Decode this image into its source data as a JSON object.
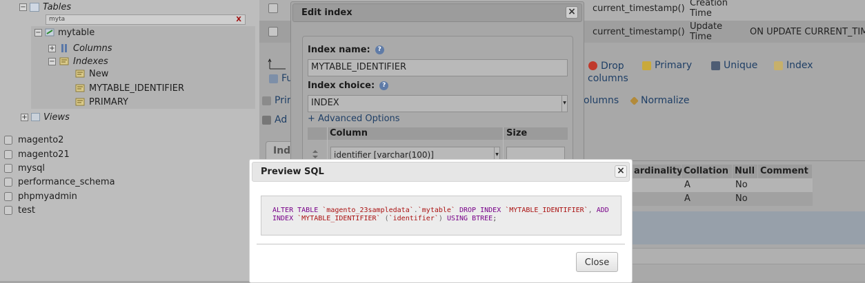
{
  "sidebar": {
    "tables_label": "Tables",
    "filter_value": "myta",
    "filter_clear": "X",
    "table_name": "mytable",
    "columns_label": "Columns",
    "indexes_label": "Indexes",
    "indexes_items": [
      "New",
      "MYTABLE_IDENTIFIER",
      "PRIMARY"
    ],
    "views_label": "Views",
    "databases": [
      "magento2",
      "magento21",
      "mysql",
      "performance_schema",
      "phpmyadmin",
      "test"
    ]
  },
  "main": {
    "rows": [
      {
        "default": "current_timestamp()",
        "comment_line1": "Creation",
        "comment_line2": "Time",
        "extra": ""
      },
      {
        "default": "current_timestamp()",
        "comment_line1": "Update",
        "comment_line2": "Time",
        "extra": "ON UPDATE CURRENT_TIM"
      }
    ],
    "actions": {
      "drop_line1": "Drop",
      "drop_line2": "columns",
      "primary": "Primary",
      "unique": "Unique",
      "index": "Index",
      "print_partial": "Prir",
      "columns_partial": "olumns",
      "normalize": "Normalize",
      "add_partial": "Ad",
      "fu_partial": "Fu",
      "ind_tab_partial": "Ind"
    },
    "index_table": {
      "headers": [
        "ardinality",
        "Collation",
        "Null",
        "Comment"
      ],
      "rows": [
        {
          "collation": "A",
          "null": "No"
        },
        {
          "collation": "A",
          "null": "No"
        }
      ]
    }
  },
  "edit_index": {
    "title": "Edit index",
    "close": "×",
    "index_name_label": "Index name:",
    "index_name_value": "MYTABLE_IDENTIFIER",
    "index_choice_label": "Index choice:",
    "index_choice_value": "INDEX",
    "advanced": "+ Advanced Options",
    "column_header": "Column",
    "size_header": "Size",
    "column_value": "identifier [varchar(100)]"
  },
  "preview_sql": {
    "title": "Preview SQL",
    "close_x": "×",
    "close_button": "Close",
    "sql": {
      "t1": "ALTER",
      "t2": "TABLE",
      "t3": "`magento_23sampledata`",
      "t4": ".",
      "t5": "`mytable`",
      "t6": "DROP",
      "t7": "INDEX",
      "t8": "`MYTABLE_IDENTIFIER`",
      "t9": ",",
      "t10": "ADD",
      "t11": "INDEX",
      "t12": "`MYTABLE_IDENTIFIER`",
      "t13": "(",
      "t14": "`identifier`",
      "t15": ")",
      "t16": "USING",
      "t17": "BTREE",
      "t18": ";"
    }
  }
}
